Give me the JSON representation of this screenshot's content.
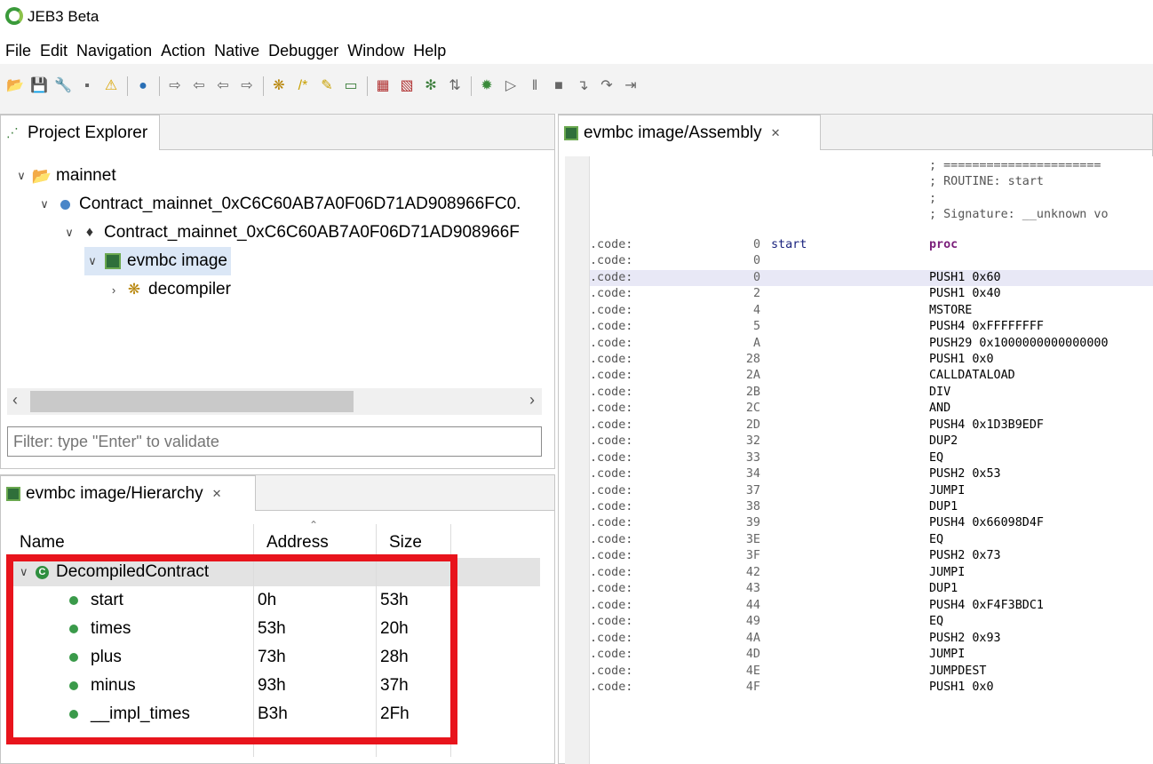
{
  "window": {
    "title": "JEB3 Beta"
  },
  "menu": [
    "File",
    "Edit",
    "Navigation",
    "Action",
    "Native",
    "Debugger",
    "Window",
    "Help"
  ],
  "toolbar": {
    "icons": [
      "open-folder-icon",
      "save-icon",
      "wrench-icon",
      "minimize-icon",
      "warning-icon",
      "globe-icon",
      "navigate-forward-icon",
      "navigate-back-icon",
      "arrow-left-icon",
      "arrow-right-icon",
      "decompile-icon",
      "comment-icon",
      "rename-icon",
      "export-icon",
      "grid-icon",
      "graph-icon",
      "nodes-icon",
      "sort-icon",
      "debug-settings-icon",
      "run-icon",
      "pause-icon",
      "stop-icon",
      "step-into-icon",
      "step-over-icon",
      "step-out-icon"
    ]
  },
  "project_explorer": {
    "tab_label": "Project Explorer",
    "tree": [
      {
        "label": "mainnet"
      },
      {
        "label": "Contract_mainnet_0xC6C60AB7A0F06D71AD908966FC0."
      },
      {
        "label": "Contract_mainnet_0xC6C60AB7A0F06D71AD908966F"
      },
      {
        "label": "evmbc image"
      },
      {
        "label": "decompiler"
      }
    ],
    "filter_placeholder": "Filter: type \"Enter\" to validate"
  },
  "hierarchy": {
    "tab_label": "evmbc image/Hierarchy",
    "columns": {
      "name": "Name",
      "address": "Address",
      "size": "Size"
    },
    "class_name": "DecompiledContract",
    "rows": [
      {
        "name": "start",
        "address": "0h",
        "size": "53h"
      },
      {
        "name": "times",
        "address": "53h",
        "size": "20h"
      },
      {
        "name": "plus",
        "address": "73h",
        "size": "28h"
      },
      {
        "name": "minus",
        "address": "93h",
        "size": "37h"
      },
      {
        "name": "__impl_times",
        "address": "B3h",
        "size": "2Fh"
      }
    ]
  },
  "assembly": {
    "tab_label": "evmbc image/Assembly",
    "header_comments": [
      "; ======================",
      "; ROUTINE: start",
      ";",
      "; Signature: __unknown vo"
    ],
    "lines": [
      {
        "seg": ".code:",
        "off": "0",
        "label": "start",
        "ins": "proc"
      },
      {
        "seg": ".code:",
        "off": "0",
        "label": "",
        "ins": ""
      },
      {
        "seg": ".code:",
        "off": "0",
        "label": "",
        "ins": "PUSH1 0x60"
      },
      {
        "seg": ".code:",
        "off": "2",
        "label": "",
        "ins": "PUSH1 0x40"
      },
      {
        "seg": ".code:",
        "off": "4",
        "label": "",
        "ins": "MSTORE"
      },
      {
        "seg": ".code:",
        "off": "5",
        "label": "",
        "ins": "PUSH4 0xFFFFFFFF"
      },
      {
        "seg": ".code:",
        "off": "A",
        "label": "",
        "ins": "PUSH29 0x1000000000000000"
      },
      {
        "seg": ".code:",
        "off": "28",
        "label": "",
        "ins": "PUSH1 0x0"
      },
      {
        "seg": ".code:",
        "off": "2A",
        "label": "",
        "ins": "CALLDATALOAD"
      },
      {
        "seg": ".code:",
        "off": "2B",
        "label": "",
        "ins": "DIV"
      },
      {
        "seg": ".code:",
        "off": "2C",
        "label": "",
        "ins": "AND"
      },
      {
        "seg": ".code:",
        "off": "2D",
        "label": "",
        "ins": "PUSH4 0x1D3B9EDF"
      },
      {
        "seg": ".code:",
        "off": "32",
        "label": "",
        "ins": "DUP2"
      },
      {
        "seg": ".code:",
        "off": "33",
        "label": "",
        "ins": "EQ"
      },
      {
        "seg": ".code:",
        "off": "34",
        "label": "",
        "ins": "PUSH2 0x53"
      },
      {
        "seg": ".code:",
        "off": "37",
        "label": "",
        "ins": "JUMPI"
      },
      {
        "seg": ".code:",
        "off": "38",
        "label": "",
        "ins": "DUP1"
      },
      {
        "seg": ".code:",
        "off": "39",
        "label": "",
        "ins": "PUSH4 0x66098D4F"
      },
      {
        "seg": ".code:",
        "off": "3E",
        "label": "",
        "ins": "EQ"
      },
      {
        "seg": ".code:",
        "off": "3F",
        "label": "",
        "ins": "PUSH2 0x73"
      },
      {
        "seg": ".code:",
        "off": "42",
        "label": "",
        "ins": "JUMPI"
      },
      {
        "seg": ".code:",
        "off": "43",
        "label": "",
        "ins": "DUP1"
      },
      {
        "seg": ".code:",
        "off": "44",
        "label": "",
        "ins": "PUSH4 0xF4F3BDC1"
      },
      {
        "seg": ".code:",
        "off": "49",
        "label": "",
        "ins": "EQ"
      },
      {
        "seg": ".code:",
        "off": "4A",
        "label": "",
        "ins": "PUSH2 0x93"
      },
      {
        "seg": ".code:",
        "off": "4D",
        "label": "",
        "ins": "JUMPI"
      },
      {
        "seg": ".code:",
        "off": "4E",
        "label": "",
        "ins": "JUMPDEST"
      },
      {
        "seg": ".code:",
        "off": "4F",
        "label": "",
        "ins": "PUSH1 0x0"
      }
    ],
    "current_line": 2
  },
  "colors": {
    "highlight_box": "#e8141c",
    "selection": "#dbe7f6",
    "method_dot": "#3a9a4a"
  }
}
